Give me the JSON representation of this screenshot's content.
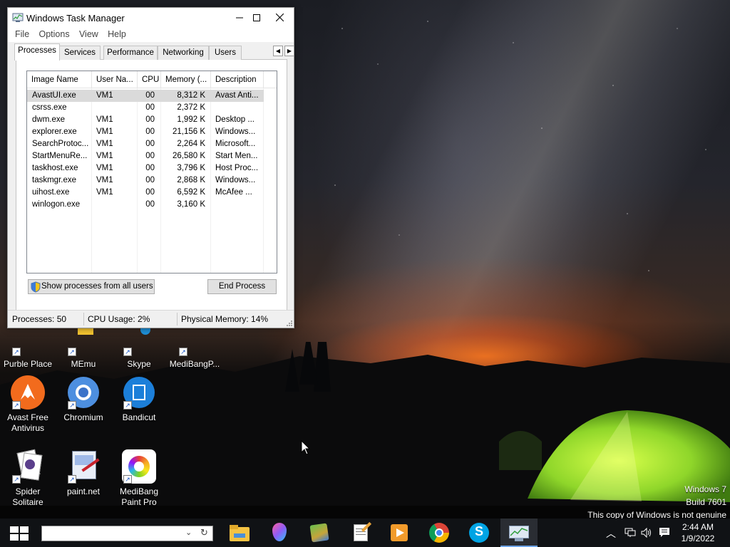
{
  "window": {
    "title": "Windows Task Manager",
    "menu": [
      "File",
      "Options",
      "View",
      "Help"
    ],
    "tabs": [
      "Processes",
      "Services",
      "Performance",
      "Networking",
      "Users"
    ],
    "active_tab": "Processes"
  },
  "table": {
    "columns": [
      "Image Name",
      "User Na...",
      "CPU",
      "Memory (...",
      "Description"
    ],
    "rows": [
      {
        "name": "AvastUI.exe",
        "user": "VM1",
        "cpu": "00",
        "memory": "8,312 K",
        "description": "Avast Anti..."
      },
      {
        "name": "csrss.exe",
        "user": "",
        "cpu": "00",
        "memory": "2,372 K",
        "description": ""
      },
      {
        "name": "dwm.exe",
        "user": "VM1",
        "cpu": "00",
        "memory": "1,992 K",
        "description": "Desktop ..."
      },
      {
        "name": "explorer.exe",
        "user": "VM1",
        "cpu": "00",
        "memory": "21,156 K",
        "description": "Windows..."
      },
      {
        "name": "SearchProtoc...",
        "user": "VM1",
        "cpu": "00",
        "memory": "2,264 K",
        "description": "Microsoft..."
      },
      {
        "name": "StartMenuRe...",
        "user": "VM1",
        "cpu": "00",
        "memory": "26,580 K",
        "description": "Start Men..."
      },
      {
        "name": "taskhost.exe",
        "user": "VM1",
        "cpu": "00",
        "memory": "3,796 K",
        "description": "Host Proc..."
      },
      {
        "name": "taskmgr.exe",
        "user": "VM1",
        "cpu": "00",
        "memory": "2,868 K",
        "description": "Windows..."
      },
      {
        "name": "uihost.exe",
        "user": "VM1",
        "cpu": "00",
        "memory": "6,592 K",
        "description": "McAfee ..."
      },
      {
        "name": "winlogon.exe",
        "user": "",
        "cpu": "00",
        "memory": "3,160 K",
        "description": ""
      }
    ]
  },
  "buttons": {
    "show_all": "Show processes from all users",
    "end_process": "End Process"
  },
  "status": {
    "processes": "Processes: 50",
    "cpu": "CPU Usage: 2%",
    "memory": "Physical Memory: 14%"
  },
  "desktop_icons": [
    {
      "label": "Purble Place",
      "icon": "purble-place-icon"
    },
    {
      "label": "MEmu",
      "icon": "memu-icon"
    },
    {
      "label": "Skype",
      "icon": "skype-icon"
    },
    {
      "label": "MediBangP...",
      "icon": "medibang-icon"
    },
    {
      "label": "Avast Free Antivirus",
      "icon": "avast-icon"
    },
    {
      "label": "Chromium",
      "icon": "chromium-icon"
    },
    {
      "label": "Bandicut",
      "icon": "bandicut-icon"
    },
    {
      "label": "Spider Solitaire",
      "icon": "spider-solitaire-icon"
    },
    {
      "label": "paint.net",
      "icon": "paintnet-icon"
    },
    {
      "label": "MediBang Paint Pro",
      "icon": "medibang-paint-pro-icon"
    }
  ],
  "watermark": {
    "line1": "Windows 7",
    "line2": "Build 7601",
    "line3": "This copy of Windows is not genuine"
  },
  "taskbar": {
    "pinned": [
      "file-explorer-icon",
      "paint-3d-icon",
      "maps-icon",
      "notepad-icon",
      "media-player-icon",
      "chrome-icon",
      "skype-icon",
      "task-manager-icon"
    ],
    "time": "2:44 AM",
    "date": "1/9/2022"
  }
}
